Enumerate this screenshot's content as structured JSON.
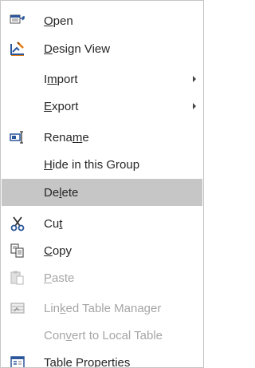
{
  "menu": {
    "items": [
      {
        "pre": "",
        "key": "O",
        "post": "pen",
        "icon": "open-icon"
      },
      {
        "pre": "",
        "key": "D",
        "post": "esign View",
        "icon": "design-view-icon"
      },
      {
        "pre": "I",
        "key": "m",
        "post": "port",
        "icon": "",
        "submenu": true
      },
      {
        "pre": "",
        "key": "E",
        "post": "xport",
        "icon": "",
        "submenu": true
      },
      {
        "pre": "Rena",
        "key": "m",
        "post": "e",
        "icon": "rename-icon"
      },
      {
        "pre": "",
        "key": "H",
        "post": "ide in this Group",
        "icon": ""
      },
      {
        "pre": "De",
        "key": "l",
        "post": "ete",
        "icon": "",
        "highlighted": true
      },
      {
        "pre": "Cu",
        "key": "t",
        "post": "",
        "icon": "cut-icon"
      },
      {
        "pre": "",
        "key": "C",
        "post": "opy",
        "icon": "copy-icon"
      },
      {
        "pre": "",
        "key": "P",
        "post": "aste",
        "icon": "paste-icon",
        "disabled": true
      },
      {
        "pre": "Lin",
        "key": "k",
        "post": "ed Table Manager",
        "icon": "linked-table-manager-icon",
        "disabled": true
      },
      {
        "pre": "Con",
        "key": "v",
        "post": "ert to Local Table",
        "icon": "",
        "disabled": true
      },
      {
        "pre": "Ta",
        "key": "b",
        "post": "le Properties",
        "icon": "table-properties-icon"
      }
    ],
    "colors": {
      "text": "#262626",
      "disabled_text": "#a6a6a6",
      "highlight": "#c6c6c6",
      "border": "#c6c6c6"
    }
  }
}
